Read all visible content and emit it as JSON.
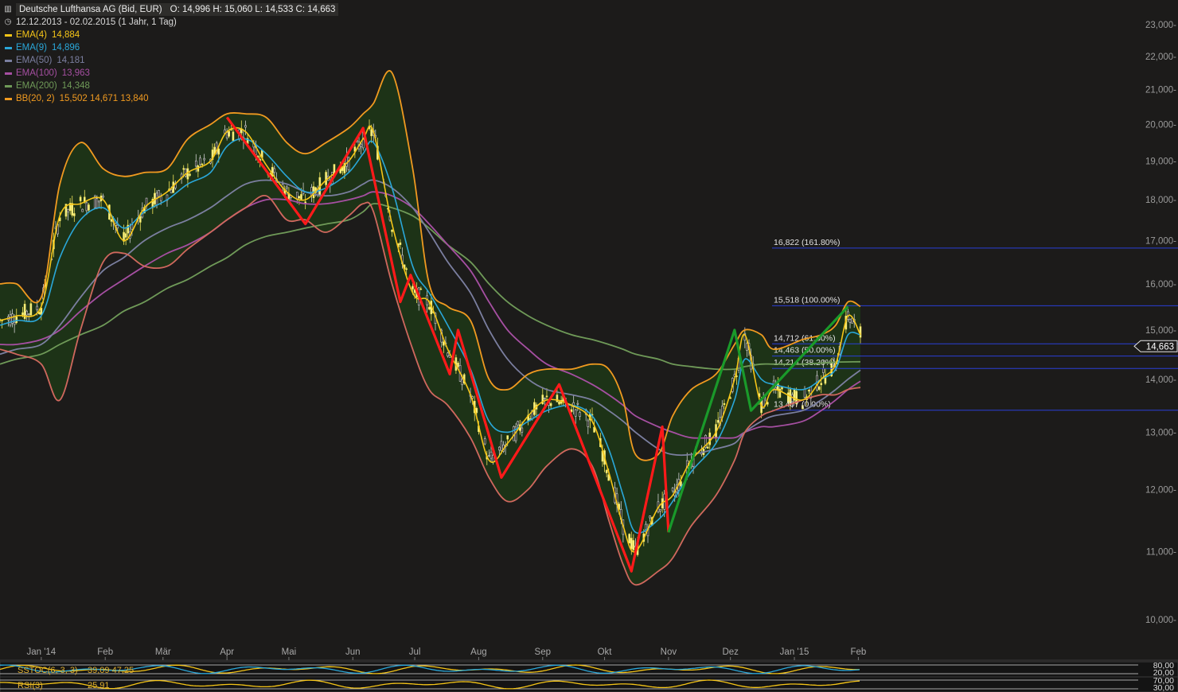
{
  "header": {
    "title_icon": "chart-icon",
    "title": "Deutsche Lufthansa AG (Bid, EUR)",
    "ohlc": "O: 14,996   H: 15,060   L: 14,533   C: 14,663",
    "range_icon": "clock-icon",
    "range": "12.12.2013 - 02.02.2015 (1 Jahr, 1 Tag)"
  },
  "indicators": [
    {
      "label": "EMA(4)",
      "value": "14,884",
      "color": "#f5c518"
    },
    {
      "label": "EMA(9)",
      "value": "14,896",
      "color": "#2aa7d9"
    },
    {
      "label": "EMA(50)",
      "value": "14,181",
      "color": "#7b7fa0"
    },
    {
      "label": "EMA(100)",
      "value": "13,963",
      "color": "#a64fa2"
    },
    {
      "label": "EMA(200)",
      "value": "14,348",
      "color": "#6f9a58"
    },
    {
      "label": "BB(20, 2)",
      "value": "15,502   14,671   13,840",
      "color": "#f09a20"
    }
  ],
  "colors": {
    "background": "#1c1b1a",
    "band_fill": "#1d3317",
    "zigzag_down": "#ff1a1a",
    "zigzag_up": "#1a9a2a",
    "fib_line": "#2a3fd8",
    "price_tag": "#1c1b1a"
  },
  "chart_data": {
    "type": "line",
    "y_axis": {
      "min": 10000,
      "max": 23000,
      "scale": "log",
      "ticks": [
        10000,
        11000,
        12000,
        13000,
        14000,
        15000,
        16000,
        17000,
        18000,
        19000,
        20000,
        21000,
        22000,
        23000
      ],
      "tick_labels": [
        "10,000-",
        "11,000-",
        "12,000-",
        "13,000-",
        "14,000-",
        "15,000-",
        "16,000-",
        "17,000-",
        "18,000-",
        "19,000-",
        "20,000-",
        "21,000-",
        "22,000-",
        "23,000-"
      ]
    },
    "x_axis": {
      "labels": [
        "Jan '14",
        "Feb",
        "Mär",
        "Apr",
        "Mai",
        "Jun",
        "Jul",
        "Aug",
        "Sep",
        "Okt",
        "Nov",
        "Dez",
        "Jan '15",
        "Feb"
      ]
    },
    "x_dates": [
      "2013-12-12",
      "2013-12-20",
      "2014-01-01",
      "2014-01-10",
      "2014-01-20",
      "2014-01-31",
      "2014-02-10",
      "2014-02-20",
      "2014-03-03",
      "2014-03-13",
      "2014-03-24",
      "2014-04-01",
      "2014-04-10",
      "2014-04-20",
      "2014-04-30",
      "2014-05-09",
      "2014-05-19",
      "2014-05-30",
      "2014-06-06",
      "2014-06-11",
      "2014-06-20",
      "2014-06-30",
      "2014-07-08",
      "2014-07-17",
      "2014-07-28",
      "2014-08-06",
      "2014-08-15",
      "2014-08-25",
      "2014-09-03",
      "2014-09-15",
      "2014-09-25",
      "2014-10-03",
      "2014-10-10",
      "2014-10-16",
      "2014-10-27",
      "2014-11-03",
      "2014-11-12",
      "2014-11-24",
      "2014-12-03",
      "2014-12-08",
      "2014-12-16",
      "2014-12-22",
      "2015-01-05",
      "2015-01-14",
      "2015-01-21",
      "2015-01-27",
      "2015-02-02"
    ],
    "series": [
      {
        "name": "EMA(4)",
        "color": "#f5c518",
        "values": [
          15200,
          15300,
          15500,
          17600,
          17900,
          18000,
          17000,
          17800,
          18200,
          18700,
          19000,
          19800,
          19800,
          18900,
          18200,
          18000,
          18500,
          19000,
          19600,
          19800,
          17400,
          15800,
          15600,
          14600,
          13700,
          12500,
          12800,
          13300,
          13600,
          13500,
          13200,
          12300,
          11400,
          11000,
          11700,
          11900,
          12500,
          13000,
          14000,
          14900,
          13500,
          13800,
          13600,
          14000,
          14300,
          15300,
          14900
        ]
      },
      {
        "name": "EMA(9)",
        "color": "#2aa7d9",
        "values": [
          15100,
          15200,
          15300,
          16600,
          17500,
          17800,
          17300,
          17700,
          18000,
          18400,
          18700,
          19400,
          19600,
          19200,
          18600,
          18200,
          18300,
          18700,
          19200,
          19500,
          18300,
          16400,
          15800,
          15100,
          14200,
          13200,
          13000,
          13200,
          13400,
          13500,
          13300,
          12700,
          11900,
          11300,
          11500,
          11800,
          12300,
          12800,
          13600,
          14400,
          14000,
          13900,
          13800,
          14000,
          14200,
          14900,
          14896
        ]
      },
      {
        "name": "EMA(50)",
        "color": "#7b7fa0",
        "values": [
          14500,
          14600,
          14700,
          15100,
          15700,
          16300,
          16600,
          17000,
          17300,
          17500,
          17800,
          18100,
          18400,
          18500,
          18400,
          18200,
          18100,
          18200,
          18400,
          18500,
          18300,
          17800,
          17200,
          16500,
          15800,
          15000,
          14400,
          14000,
          13800,
          13700,
          13600,
          13400,
          13200,
          13000,
          12700,
          12600,
          12600,
          12700,
          12800,
          13000,
          13200,
          13300,
          13400,
          13600,
          13800,
          14000,
          14181
        ]
      },
      {
        "name": "EMA(100)",
        "color": "#a64fa2",
        "values": [
          14700,
          14700,
          14800,
          15000,
          15400,
          15800,
          16100,
          16400,
          16700,
          16900,
          17200,
          17500,
          17800,
          18000,
          18000,
          17900,
          17900,
          18000,
          18100,
          18200,
          18100,
          17800,
          17400,
          16900,
          16300,
          15600,
          15000,
          14600,
          14300,
          14100,
          13900,
          13700,
          13500,
          13300,
          13100,
          13000,
          12900,
          12900,
          12900,
          13000,
          13100,
          13100,
          13200,
          13400,
          13600,
          13800,
          13963
        ]
      },
      {
        "name": "EMA(200)",
        "color": "#6f9a58",
        "values": [
          14300,
          14400,
          14500,
          14700,
          14900,
          15100,
          15400,
          15600,
          15900,
          16100,
          16400,
          16600,
          16900,
          17100,
          17200,
          17300,
          17400,
          17500,
          17700,
          17900,
          17800,
          17600,
          17300,
          16900,
          16500,
          16000,
          15600,
          15300,
          15100,
          14900,
          14800,
          14700,
          14600,
          14500,
          14400,
          14300,
          14250,
          14200,
          14200,
          14250,
          14300,
          14300,
          14300,
          14320,
          14340,
          14345,
          14348
        ]
      },
      {
        "name": "BB upper",
        "color": "#f09a20",
        "values": [
          16000,
          16000,
          15700,
          18400,
          19500,
          18800,
          18600,
          18700,
          18800,
          19600,
          20000,
          20300,
          20300,
          20200,
          19500,
          19200,
          19500,
          19900,
          20300,
          20600,
          21500,
          18800,
          16000,
          15500,
          15200,
          14000,
          13800,
          14100,
          14200,
          14200,
          14300,
          14200,
          13600,
          12600,
          12600,
          13300,
          13800,
          14100,
          14700,
          15000,
          14900,
          14600,
          14800,
          14900,
          15100,
          15600,
          15502
        ]
      },
      {
        "name": "BB lower",
        "color": "#d0685e",
        "values": [
          14600,
          14500,
          14300,
          13600,
          15000,
          16500,
          16700,
          16400,
          16400,
          16800,
          17200,
          17500,
          17800,
          18100,
          17500,
          17500,
          17200,
          17600,
          17900,
          17700,
          16000,
          14600,
          13800,
          13500,
          12900,
          12200,
          11800,
          12000,
          12400,
          12700,
          12400,
          11500,
          10800,
          10500,
          10700,
          10900,
          11400,
          11900,
          12500,
          13000,
          13300,
          13400,
          13600,
          13700,
          13700,
          13800,
          13840
        ]
      }
    ],
    "zigzag_red": [
      {
        "x": "2014-04-01",
        "y": 20200
      },
      {
        "x": "2014-05-09",
        "y": 17400
      },
      {
        "x": "2014-06-06",
        "y": 19900
      },
      {
        "x": "2014-06-24",
        "y": 15600
      },
      {
        "x": "2014-06-29",
        "y": 16200
      },
      {
        "x": "2014-07-18",
        "y": 14100
      },
      {
        "x": "2014-07-22",
        "y": 15000
      },
      {
        "x": "2014-08-12",
        "y": 12200
      },
      {
        "x": "2014-09-09",
        "y": 13900
      },
      {
        "x": "2014-10-14",
        "y": 10700
      },
      {
        "x": "2014-10-29",
        "y": 13100
      },
      {
        "x": "2014-11-01",
        "y": 11300
      }
    ],
    "zigzag_green": [
      {
        "x": "2014-11-01",
        "y": 11300
      },
      {
        "x": "2014-12-03",
        "y": 15000
      },
      {
        "x": "2014-12-11",
        "y": 13400
      },
      {
        "x": "2015-01-27",
        "y": 15500
      }
    ],
    "fib_levels": [
      {
        "value": 16822,
        "label": "16,822 (161.80%)"
      },
      {
        "value": 15518,
        "label": "15,518 (100.00%)"
      },
      {
        "value": 14712,
        "label": "14,712 (61.80%)"
      },
      {
        "value": 14463,
        "label": "14,463 (50.00%)"
      },
      {
        "value": 14214,
        "label": "14,214 (38.20%)"
      },
      {
        "value": 13407,
        "label": "13,407 (0.00%)"
      }
    ],
    "last_price": {
      "value": 14663,
      "label": "14,663"
    }
  },
  "subpanels": [
    {
      "label": "SSTOC(6, 3, 3)",
      "values": "39,09   47,25",
      "ticks": [
        "80,00",
        "20,00"
      ],
      "line_colors": [
        "#f5c518",
        "#2aa7d9"
      ]
    },
    {
      "label": "RSI(3)",
      "values": "25,91",
      "ticks": [
        "70,00",
        "30,00"
      ],
      "line_colors": [
        "#f5c518"
      ]
    }
  ]
}
